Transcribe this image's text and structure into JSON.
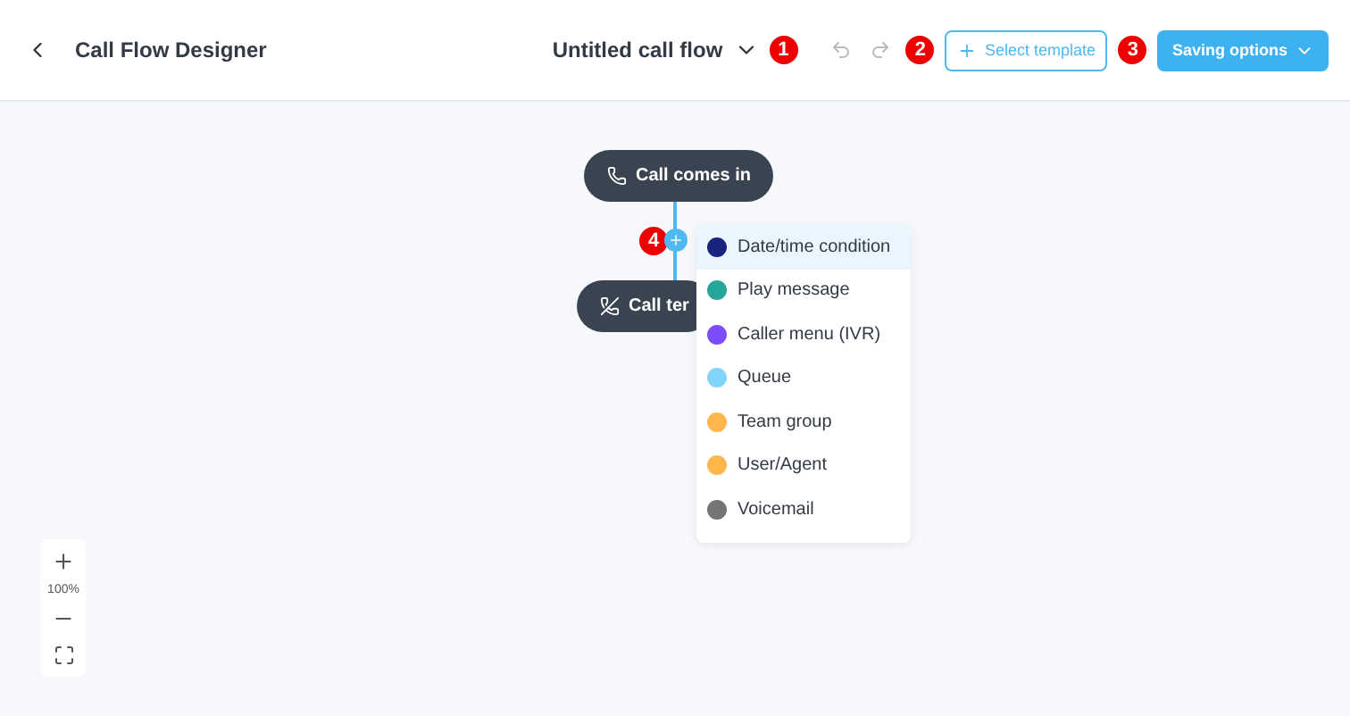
{
  "header": {
    "title": "Call Flow Designer",
    "flow_name": "Untitled call flow",
    "template_button": "Select template",
    "saving_button": "Saving options"
  },
  "markers": [
    "1",
    "2",
    "3",
    "4"
  ],
  "nodes": [
    {
      "kind": "start",
      "label": "Call comes in"
    },
    {
      "kind": "end",
      "label": "Call ter"
    }
  ],
  "menu": [
    {
      "label": "Date/time condition",
      "color": "#1a237e",
      "selected": true
    },
    {
      "label": "Play message",
      "color": "#26a69a",
      "selected": false
    },
    {
      "label": "Caller menu (IVR)",
      "color": "#7c4dff",
      "selected": false
    },
    {
      "label": "Queue",
      "color": "#81d4fa",
      "selected": false
    },
    {
      "label": "Team group",
      "color": "#ffb74d",
      "selected": false
    },
    {
      "label": "User/Agent",
      "color": "#ffb74d",
      "selected": false
    },
    {
      "label": "Voicemail",
      "color": "#757575",
      "selected": false
    }
  ],
  "zoom": {
    "level_text": "100%"
  }
}
